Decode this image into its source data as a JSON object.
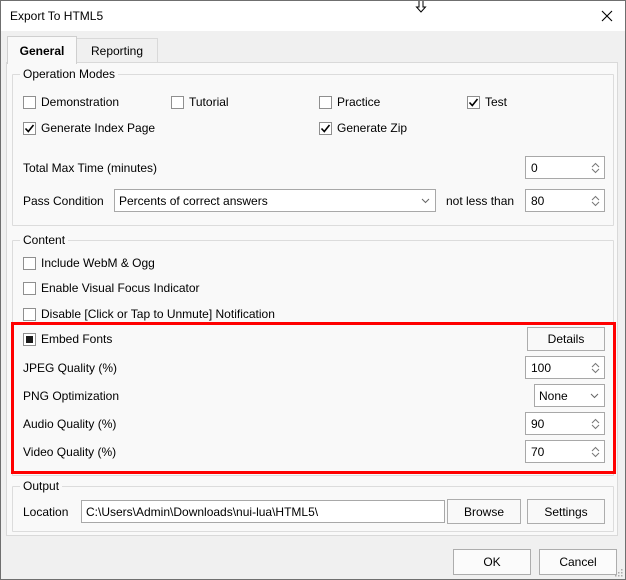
{
  "window": {
    "title": "Export To HTML5",
    "close_icon": "close-icon",
    "cursor_icon": "resize-cursor-icon"
  },
  "tabs": [
    {
      "label": "General",
      "active": true
    },
    {
      "label": "Reporting",
      "active": false
    }
  ],
  "operation_modes": {
    "title": "Operation Modes",
    "checkboxes": [
      {
        "label": "Demonstration",
        "checked": false
      },
      {
        "label": "Tutorial",
        "checked": false
      },
      {
        "label": "Practice",
        "checked": false
      },
      {
        "label": "Test",
        "checked": true
      },
      {
        "label": "Generate Index Page",
        "checked": true
      },
      {
        "label": "Generate Zip",
        "checked": true
      }
    ],
    "total_max_time": {
      "label": "Total Max Time (minutes)",
      "value": "0"
    },
    "pass_condition": {
      "label": "Pass Condition",
      "selected": "Percents of correct answers",
      "comparator_label": "not less than",
      "value": "80"
    }
  },
  "content": {
    "title": "Content",
    "checkboxes": [
      {
        "label": "Include WebM & Ogg",
        "checked": false
      },
      {
        "label": "Enable Visual Focus Indicator",
        "checked": false
      },
      {
        "label": "Disable [Click or Tap to Unmute] Notification",
        "checked": false
      },
      {
        "label": "Embed Fonts",
        "checked": "indeterminate"
      }
    ],
    "details_button": "Details",
    "jpeg_quality": {
      "label": "JPEG Quality (%)",
      "value": "100"
    },
    "png_optimization": {
      "label": "PNG Optimization",
      "selected": "None"
    },
    "audio_quality": {
      "label": "Audio Quality (%)",
      "value": "90"
    },
    "video_quality": {
      "label": "Video Quality (%)",
      "value": "70"
    },
    "highlight_color": "#ff0000"
  },
  "output": {
    "title": "Output",
    "location_label": "Location",
    "location_value": "C:\\Users\\Admin\\Downloads\\nui-lua\\HTML5\\",
    "browse_button": "Browse",
    "settings_button": "Settings"
  },
  "footer": {
    "ok_button": "OK",
    "cancel_button": "Cancel"
  }
}
